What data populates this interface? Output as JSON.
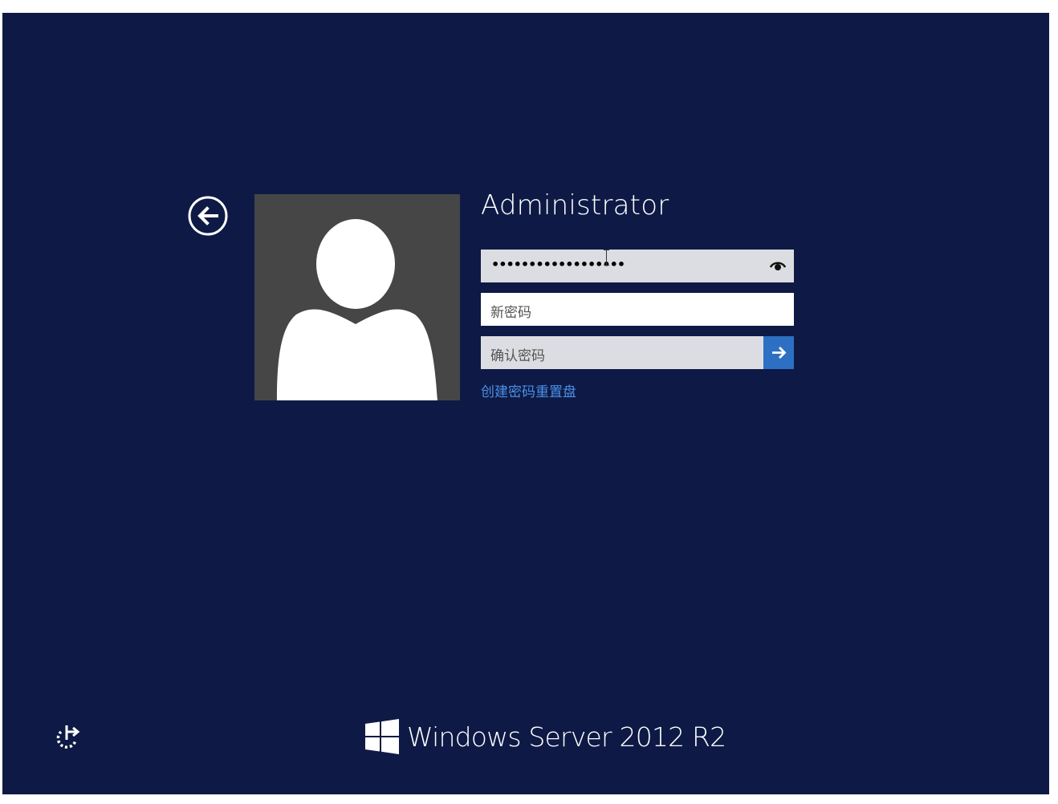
{
  "user": {
    "name": "Administrator"
  },
  "password_fields": {
    "old_password_masked": "••••••••••••••••••",
    "new_password_placeholder": "新密码",
    "confirm_password_placeholder": "确认密码"
  },
  "links": {
    "create_reset_disk": "创建密码重置盘"
  },
  "branding": {
    "product_name": "Windows Server 2012 R2"
  },
  "icons": {
    "back": "back-arrow-icon",
    "reveal": "eye-icon",
    "submit": "arrow-right-icon",
    "ease_of_access": "ease-of-access-icon",
    "logo": "windows-logo-icon"
  },
  "colors": {
    "background": "#0e1a45",
    "avatar_tile": "#464646",
    "submit_button": "#2d6fc2",
    "link": "#4a90e8"
  }
}
